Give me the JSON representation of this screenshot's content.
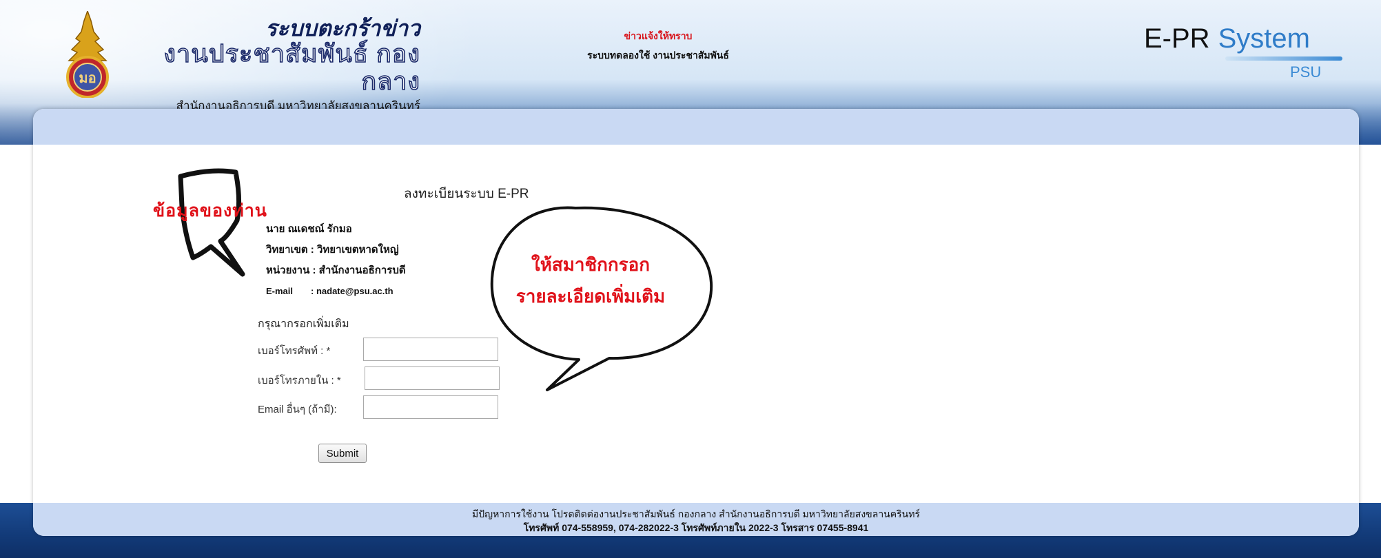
{
  "header": {
    "system_name": "ระบบตะกร้าข่าว",
    "department": "งานประชาสัมพันธ์ กองกลาง",
    "office": "สำนักงานอธิการบดี มหาวิทยาลัยสงขลานครินทร์",
    "news_headline": "ข่าวแจ้งให้ทราบ",
    "news_sub": "ระบบทดลองใช้ งานประชาสัมพันธ์",
    "epr_logo": {
      "part1": "E-PR",
      "part2": "System",
      "part3": "PSU"
    }
  },
  "form": {
    "title": "ลงทะเบียนระบบ E-PR",
    "user": {
      "name": "นาย ณเดชณ์ รักมอ",
      "campus": "วิทยาเขต : วิทยาเขตหาดใหญ่",
      "unit": "หน่วยงาน : สำนักงานอธิการบดี",
      "email_label": "E-mail",
      "email_value": ": nadate@psu.ac.th"
    },
    "more_info_title": "กรุณากรอกเพิ่มเติม",
    "fields": [
      {
        "label": "เบอร์โทรศัพท์ : *",
        "value": ""
      },
      {
        "label": "เบอร์โทรภายใน : *",
        "value": ""
      },
      {
        "label": "Email อื่นๆ (ถ้ามี):",
        "value": ""
      }
    ],
    "submit_label": "Submit"
  },
  "annotations": {
    "your_info": "ข้อมูลของท่าน",
    "fill_more_line1": "ให้สมาชิกกรอก",
    "fill_more_line2": "รายละเอียดเพิ่มเติม"
  },
  "footer": {
    "line1": "มีปัญหาการใช้งาน โปรดติดต่องานประชาสัมพันธ์ กองกลาง สำนักงานอธิการบดี มหาวิทยาลัยสงขลานครินทร์",
    "line2": "โทรศัพท์ 074-558959, 074-282022-3 โทรศัพท์ภายใน 2022-3 โทรสาร 07455-8941"
  },
  "colors": {
    "panel_band": "#c9d9f3",
    "annotation_red": "#e0121a",
    "epr_blue": "#2f7cc8",
    "news_red": "#d8141b"
  }
}
